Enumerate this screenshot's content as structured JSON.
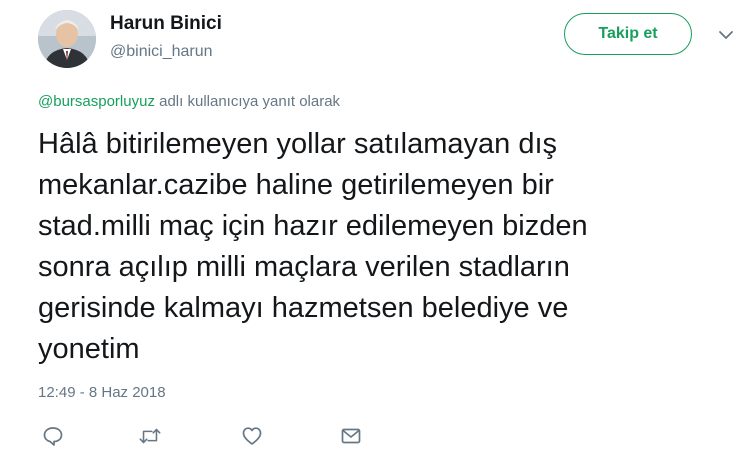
{
  "header": {
    "display_name": "Harun Binici",
    "username": "@binici_harun",
    "follow_label": "Takip et",
    "accent_color": "#17a05d"
  },
  "icons": {
    "avatar": "profile-photo",
    "menu": "chevron-down-icon",
    "reply": "reply-icon",
    "retweet": "retweet-icon",
    "like": "heart-icon",
    "message": "envelope-icon"
  },
  "reply_context": {
    "mention": "@bursasporluyuz",
    "suffix": " adlı kullanıcıya yanıt olarak"
  },
  "tweet": {
    "text": "Hâlâ bitirilemeyen yollar satılamayan dış\nmekanlar.cazibe haline getirilemeyen bir\nstad.milli maç için hazır edilemeyen bizden\nsonra açılıp milli maçlara verilen stadların\ngerisinde kalmayı hazmetsen belediye ve\nyonetim",
    "timestamp": "12:49 - 8 Haz 2018"
  }
}
